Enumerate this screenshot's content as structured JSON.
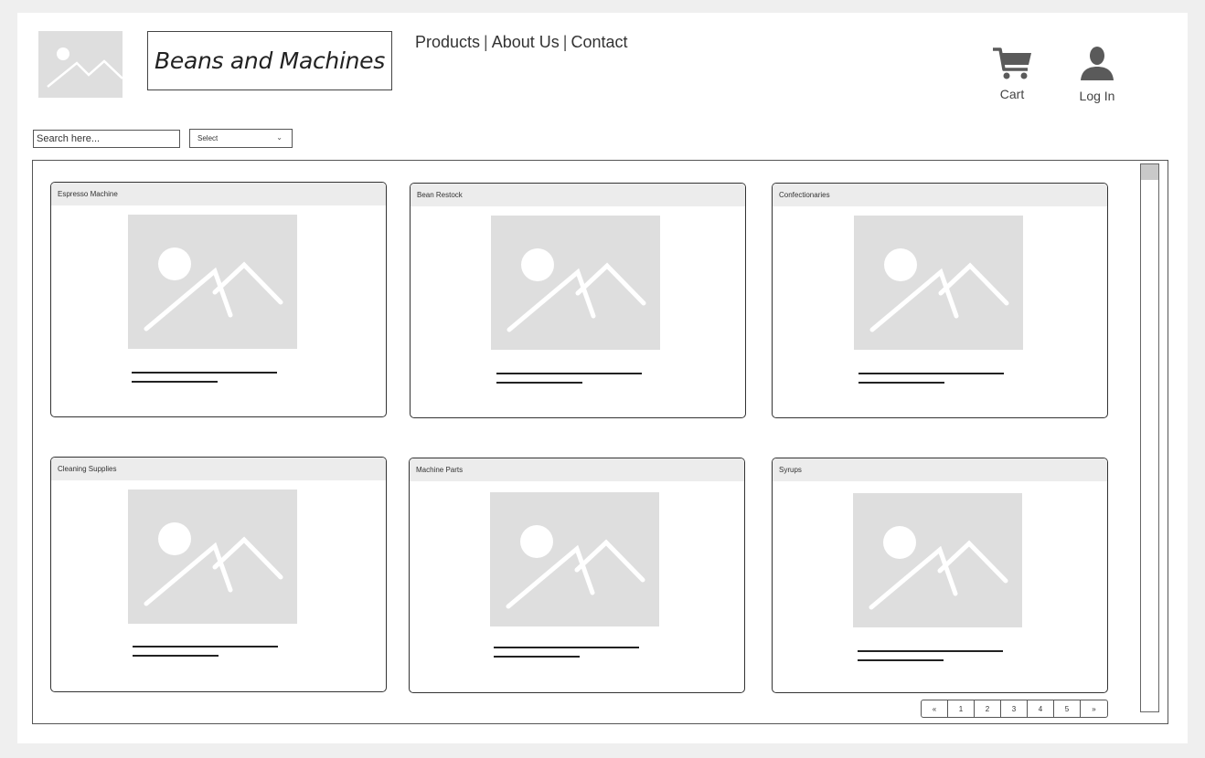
{
  "header": {
    "brand": "Beans and Machines",
    "nav": [
      {
        "label": "Products"
      },
      {
        "label": "About Us"
      },
      {
        "label": "Contact"
      }
    ],
    "nav_separator": "|",
    "cart_label": "Cart",
    "login_label": "Log In"
  },
  "filters": {
    "search_placeholder": "Search here...",
    "select_value": "Select",
    "select_chevron": "⌄"
  },
  "products": [
    {
      "title": "Espresso Machine"
    },
    {
      "title": "Bean Restock"
    },
    {
      "title": "Confectionaries"
    },
    {
      "title": "Cleaning Supplies"
    },
    {
      "title": "Machine Parts"
    },
    {
      "title": "Syrups"
    }
  ],
  "pagination": {
    "prev": "«",
    "pages": [
      "1",
      "2",
      "3",
      "4",
      "5"
    ],
    "next": "»"
  },
  "icons": {
    "cart": "cart-icon",
    "login": "user-icon",
    "placeholder": "image-placeholder-icon"
  },
  "colors": {
    "placeholder_bg": "#dedede",
    "header_bg": "#ececec",
    "page_bg": "#efefef"
  }
}
